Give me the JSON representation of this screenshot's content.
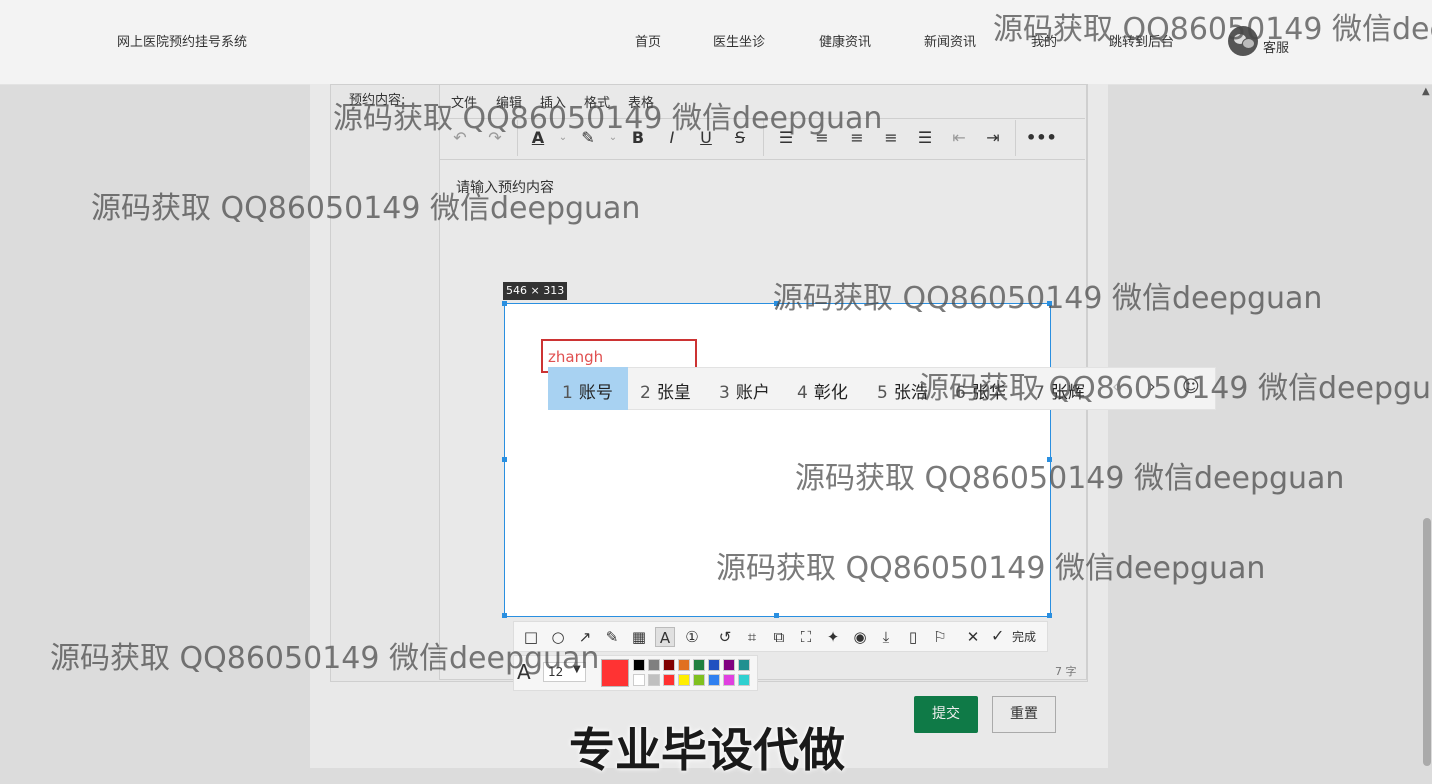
{
  "nav": {
    "brand": "网上医院预约挂号系统",
    "items": [
      "首页",
      "医生坐诊",
      "健康资讯",
      "新闻资讯",
      "我的",
      "跳转到后台"
    ],
    "service_label": "客服"
  },
  "form": {
    "content_label": "预约内容:",
    "editor": {
      "menus": [
        "文件",
        "编辑",
        "插入",
        "格式",
        "表格"
      ],
      "placeholder": "请输入预约内容",
      "word_count": "7 字",
      "toolbar_icons": [
        "undo-icon",
        "redo-icon",
        "font-color-icon",
        "highlight-icon",
        "bold-icon",
        "italic-icon",
        "underline-icon",
        "strikethrough-icon",
        "list-icon",
        "align-left-icon",
        "align-center-icon",
        "align-right-icon",
        "justify-icon",
        "outdent-icon",
        "indent-icon",
        "more-icon"
      ]
    },
    "submit_label": "提交",
    "reset_label": "重置"
  },
  "capture": {
    "size_label": "546 × 313",
    "typed_text": "zhangh",
    "ime": {
      "selected_index": 0,
      "candidates": [
        {
          "num": "1",
          "text": "账号"
        },
        {
          "num": "2",
          "text": "张皇"
        },
        {
          "num": "3",
          "text": "账户"
        },
        {
          "num": "4",
          "text": "彰化"
        },
        {
          "num": "5",
          "text": "张浩"
        },
        {
          "num": "6",
          "text": "张华"
        },
        {
          "num": "7",
          "text": "张辉"
        }
      ]
    },
    "toolbar": {
      "done_label": "完成",
      "tools": [
        "rectangle-icon",
        "ellipse-icon",
        "arrow-icon",
        "pen-icon",
        "mosaic-icon",
        "text-icon",
        "number-icon",
        "undo-icon",
        "crop-icon",
        "translate-icon",
        "ocr-icon",
        "pin-icon",
        "record-icon",
        "download-icon",
        "save-icon",
        "bookmark-icon",
        "close-icon",
        "done-icon"
      ]
    },
    "palette": {
      "font_size": "12",
      "current_color": "#ff3333",
      "swatches_top": [
        "#000000",
        "#808080",
        "#800000",
        "#e07020",
        "#208040",
        "#2050c0",
        "#800080",
        "#209090"
      ],
      "swatches_bottom": [
        "#ffffff",
        "#c0c0c0",
        "#ff3030",
        "#ffee00",
        "#80c020",
        "#3080f0",
        "#e040e0",
        "#30d0d0"
      ]
    }
  },
  "watermark": "源码获取 QQ86050149 微信deepguan",
  "caption": "专业毕设代做"
}
